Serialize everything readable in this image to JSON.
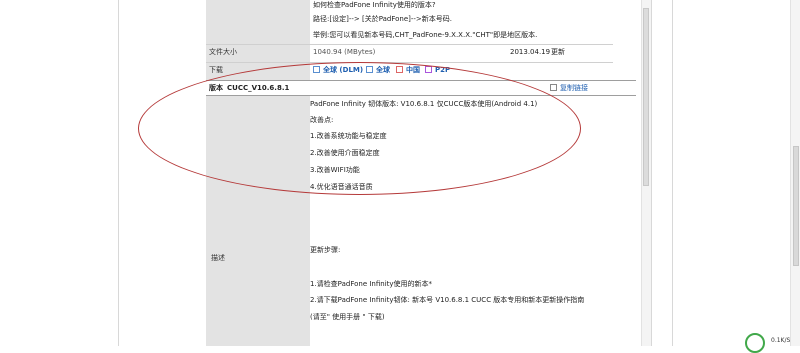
{
  "info_lines": [
    "如何检查PadFone Infinity使用的版本?",
    "路径:[设定]--> [关於PadFone]-->新本号码.",
    "举例:您可以看见新本号码,CHT_PadFone-9.X.X.X.\"CHT\"即是地区版本."
  ],
  "file_size": {
    "label": "文件大小",
    "value": "1040.94 (MBytes)",
    "date": "2013.04.19",
    "update": "更新"
  },
  "download": {
    "label": "下载",
    "links": [
      "全球 (DLM)",
      "全球",
      "中国",
      "P2P"
    ]
  },
  "version": {
    "label": "版本",
    "name": "CUCC_V10.6.8.1",
    "copy_link": "复制链接"
  },
  "description": {
    "label": "描述",
    "lines": [
      "PadFone Infinity 韧体版本: V10.6.8.1 仅CUCC版本使用(Android 4.1)",
      "改善点:",
      "1.改善系统功能与稳定度",
      "2.改善使用介面稳定度",
      "3.改善WIFI功能",
      "4.优化语音通话音质"
    ],
    "steps_title": "更新步骤:",
    "steps": [
      "1.请检查PadFone Infinity使用的新本*",
      "2.请下载PadFone Infinity韧体: 新本号  V10.6.8.1 CUCC 版本专用和新本更新操作指南",
      "(请至\" 使用手册 \" 下载)"
    ]
  },
  "status_bar": {
    "speed": "0.1K/S"
  },
  "colors": {
    "link": "#1f5fb0",
    "annotation": "#b53a3a",
    "label_bg": "#e3e3e3"
  }
}
